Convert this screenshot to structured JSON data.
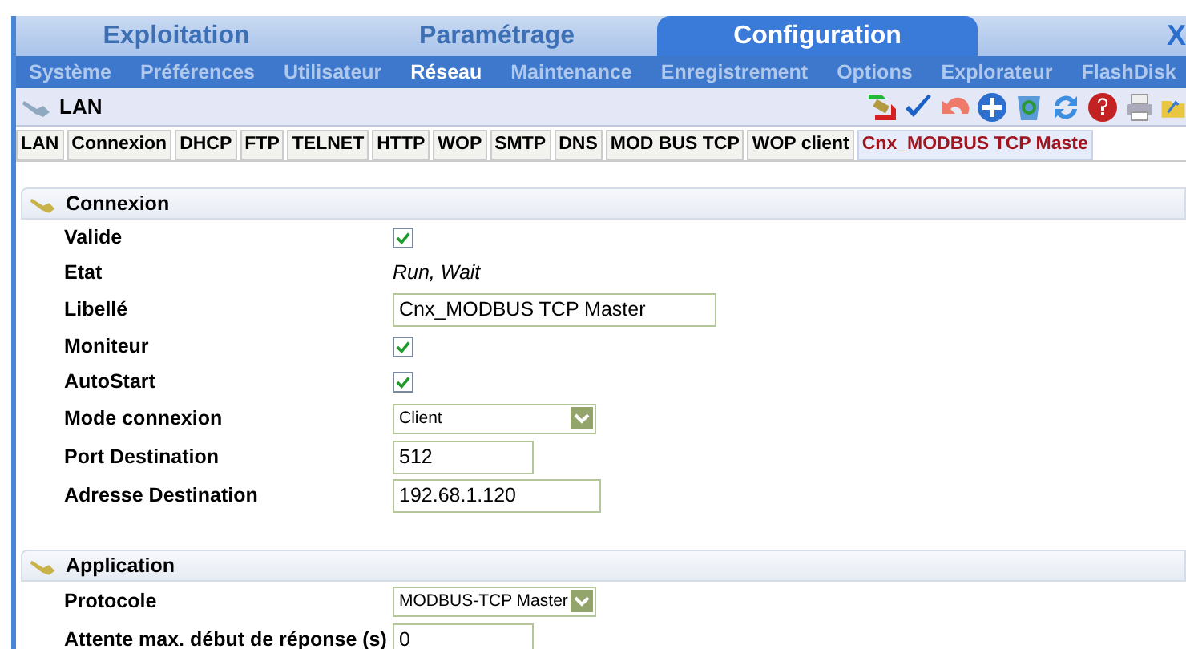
{
  "main_tabs": [
    {
      "label": "Exploitation",
      "selected": false
    },
    {
      "label": "Paramétrage",
      "selected": false
    },
    {
      "label": "Configuration",
      "selected": true
    }
  ],
  "close_glyph": "X",
  "menu": [
    {
      "label": "Système",
      "selected": false
    },
    {
      "label": "Préférences",
      "selected": false
    },
    {
      "label": "Utilisateur",
      "selected": false
    },
    {
      "label": "Réseau",
      "selected": true
    },
    {
      "label": "Maintenance",
      "selected": false
    },
    {
      "label": "Enregistrement",
      "selected": false
    },
    {
      "label": "Options",
      "selected": false
    },
    {
      "label": "Explorateur",
      "selected": false
    },
    {
      "label": "FlashDisk",
      "selected": false
    }
  ],
  "page_title": "LAN",
  "sub_tabs": [
    {
      "label": "LAN",
      "selected": false
    },
    {
      "label": "Connexion",
      "selected": false
    },
    {
      "label": "DHCP",
      "selected": false
    },
    {
      "label": "FTP",
      "selected": false
    },
    {
      "label": "TELNET",
      "selected": false
    },
    {
      "label": "HTTP",
      "selected": false
    },
    {
      "label": "WOP",
      "selected": false
    },
    {
      "label": "SMTP",
      "selected": false
    },
    {
      "label": "DNS",
      "selected": false
    },
    {
      "label": "MOD BUS TCP",
      "selected": false
    },
    {
      "label": "WOP client",
      "selected": false
    },
    {
      "label": "Cnx_MODBUS TCP Maste",
      "selected": true
    }
  ],
  "sections": [
    {
      "title": "Connexion",
      "fields": [
        {
          "label": "Valide",
          "kind": "checkbox",
          "checked": true
        },
        {
          "label": "Etat",
          "kind": "text",
          "value": "Run, Wait"
        },
        {
          "label": "Libellé",
          "kind": "input",
          "value": "Cnx_MODBUS TCP Master"
        },
        {
          "label": "Moniteur",
          "kind": "checkbox",
          "checked": true
        },
        {
          "label": "AutoStart",
          "kind": "checkbox",
          "checked": true
        },
        {
          "label": "Mode connexion",
          "kind": "select",
          "value": "Client"
        },
        {
          "label": "Port Destination",
          "kind": "input",
          "value": "512"
        },
        {
          "label": "Adresse Destination",
          "kind": "input",
          "value": "192.68.1.120"
        }
      ]
    },
    {
      "title": "Application",
      "fields": [
        {
          "label": "Protocole",
          "kind": "select",
          "value": "MODBUS-TCP Master"
        },
        {
          "label": "Attente max. début de réponse (s)",
          "kind": "input",
          "value": "0"
        }
      ]
    }
  ]
}
